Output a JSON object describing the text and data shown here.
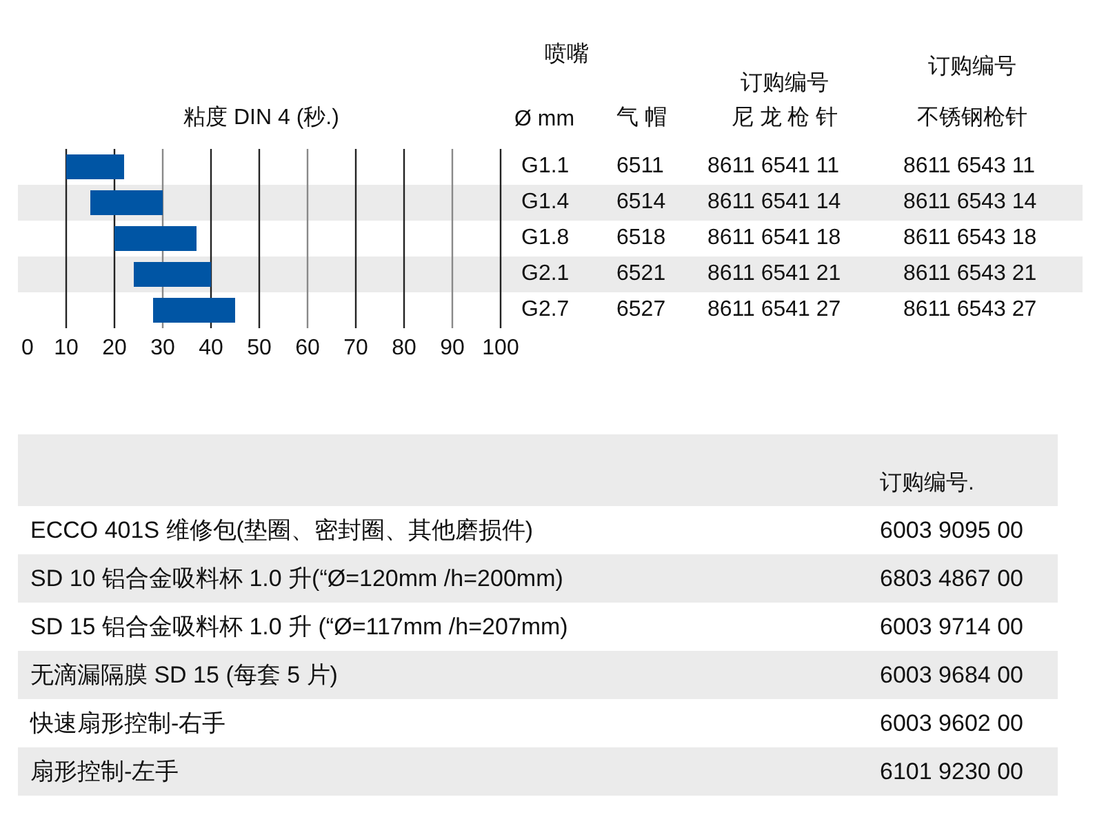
{
  "viscosity_chart": {
    "heading": "粘度 DIN 4 (秒.)",
    "axis_labels": [
      "0",
      "10",
      "20",
      "30",
      "40",
      "50",
      "60",
      "70",
      "80",
      "90",
      "100"
    ]
  },
  "nozzle_table": {
    "group_heading": "喷嘴",
    "columns": [
      {
        "lines": [
          "Ø mm"
        ]
      },
      {
        "lines": [
          "气 帽"
        ]
      },
      {
        "lines": [
          "订购编号",
          "尼 龙 枪 针"
        ]
      },
      {
        "lines": [
          "订购编号",
          "不锈钢枪针"
        ]
      }
    ],
    "rows": [
      [
        "G1.1",
        "6511",
        "8611 6541 11",
        "8611 6543 11"
      ],
      [
        "G1.4",
        "6514",
        "8611 6541 14",
        "8611 6543 14"
      ],
      [
        "G1.8",
        "6518",
        "8611 6541 18",
        "8611 6543 18"
      ],
      [
        "G2.1",
        "6521",
        "8611 6541 21",
        "8611 6543 21"
      ],
      [
        "G2.7",
        "6527",
        "8611 6541 27",
        "8611 6543 27"
      ]
    ]
  },
  "parts_table": {
    "order_heading": "订购编号.",
    "rows": [
      {
        "description": "ECCO 401S 维修包(垫圈、密封圈、其他磨损件)",
        "order_no": "6003 9095 00"
      },
      {
        "description": "SD 10 铝合金吸料杯 1.0 升(“Ø=120mm /h=200mm)",
        "order_no": "6803 4867 00"
      },
      {
        "description": "SD 15 铝合金吸料杯 1.0 升 (“Ø=117mm /h=207mm)",
        "order_no": "6003 9714 00"
      },
      {
        "description": "无滴漏隔膜 SD 15 (每套 5 片)",
        "order_no": "6003 9684 00"
      },
      {
        "description": "快速扇形控制-右手",
        "order_no": "6003 9602 00"
      },
      {
        "description": "扇形控制-左手",
        "order_no": "6101 9230 00"
      }
    ]
  }
}
